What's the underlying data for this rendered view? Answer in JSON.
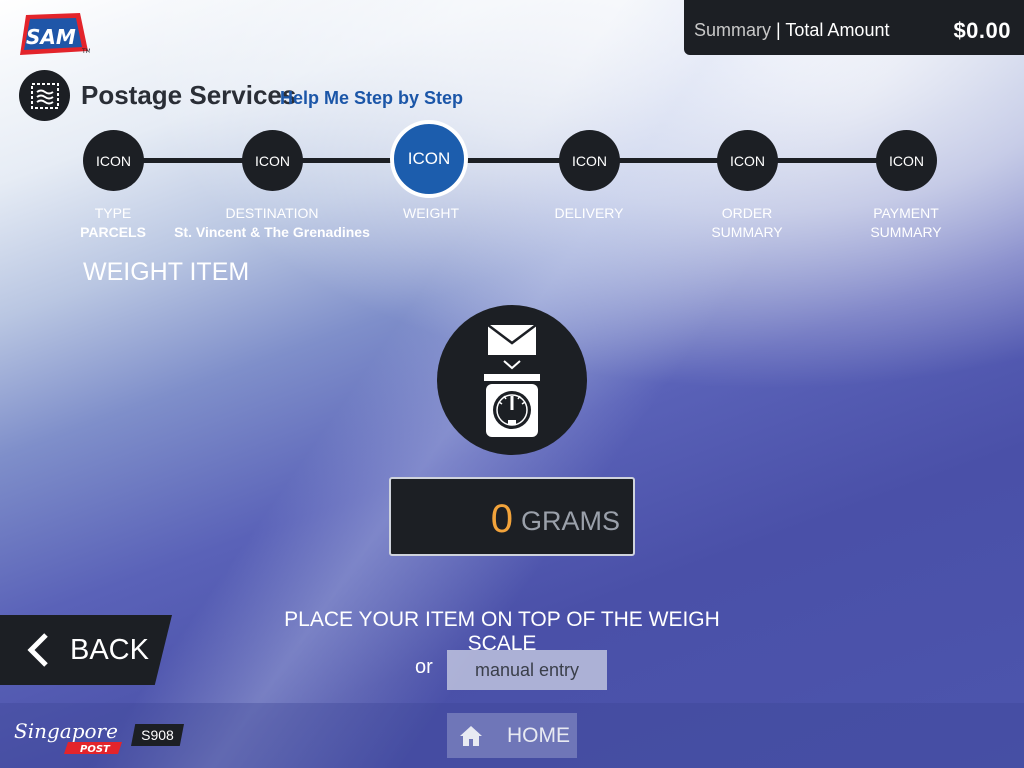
{
  "app": {
    "logo_text": "SAM",
    "logo_tm": "TM"
  },
  "summary": {
    "label": "Summary",
    "separator": "|",
    "total_label": "Total Amount",
    "amount": "$0.00"
  },
  "service": {
    "title": "Postage Services",
    "help_link": "Help Me Step by Step"
  },
  "steps": [
    {
      "icon_text": "ICON",
      "label": "TYPE",
      "value": "PARCELS",
      "active": false
    },
    {
      "icon_text": "ICON",
      "label": "DESTINATION",
      "value": "St. Vincent & The Grenadines",
      "active": false
    },
    {
      "icon_text": "ICON",
      "label": "WEIGHT",
      "value": "",
      "active": true
    },
    {
      "icon_text": "ICON",
      "label": "DELIVERY",
      "value": "",
      "active": false
    },
    {
      "icon_text": "ICON",
      "label": "ORDER",
      "value": "SUMMARY",
      "active": false
    },
    {
      "icon_text": "ICON",
      "label": "PAYMENT",
      "value": "SUMMARY",
      "active": false
    }
  ],
  "section": {
    "title": "WEIGHT ITEM"
  },
  "weight": {
    "value": "0",
    "unit": "GRAMS"
  },
  "instruction": {
    "text": "PLACE YOUR ITEM ON TOP OF THE WEIGH SCALE",
    "or": "or",
    "manual_entry": "manual entry"
  },
  "nav": {
    "back": "BACK",
    "home": "HOME"
  },
  "footer": {
    "brand_script": "Singapore",
    "brand_post": "POST",
    "kiosk_id": "S908"
  },
  "colors": {
    "dark": "#1c1f24",
    "accent_blue": "#1c5dad",
    "link_blue": "#1b56a8",
    "weight_orange": "#f2a33b",
    "sam_red": "#e3242b",
    "sam_blue": "#1f56a8"
  }
}
